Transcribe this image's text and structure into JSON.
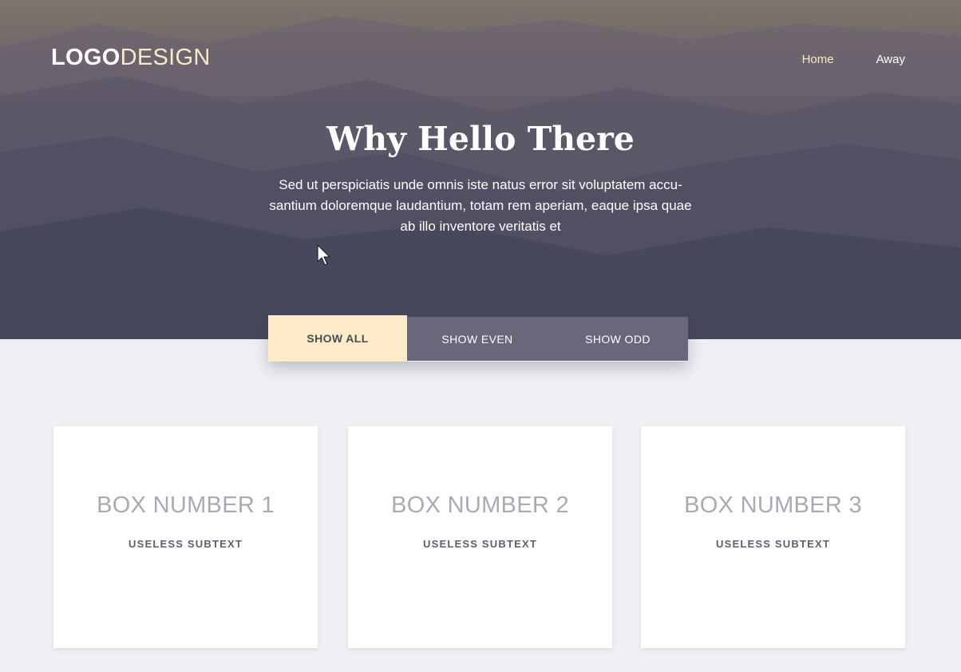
{
  "logo": {
    "part_bold": "LOGO",
    "part_light": "DESIGN"
  },
  "nav": {
    "items": [
      "Home",
      "Away"
    ]
  },
  "hero": {
    "title": "Why Hello There",
    "body": "Sed ut perspiciatis unde omnis iste natus error sit voluptatem accu-santium doloremque laudantium, totam rem aperiam, eaque ipsa quae ab illo inventore veritatis et"
  },
  "filters": {
    "active": "SHOW ALL",
    "items": [
      "SHOW ALL",
      "SHOW EVEN",
      "SHOW ODD"
    ]
  },
  "boxes": [
    {
      "title": "BOX NUMBER 1",
      "subtitle": "USELESS SUBTEXT"
    },
    {
      "title": "BOX NUMBER 2",
      "subtitle": "USELESS SUBTEXT"
    },
    {
      "title": "BOX NUMBER 3",
      "subtitle": "USELESS SUBTEXT"
    }
  ],
  "colors": {
    "accent": "#fcebc6",
    "filter_bar": "#6b6679",
    "page_bg": "#eef0f4",
    "box_title": "#a9abb3",
    "box_subtitle": "#5f5e6f"
  },
  "icons": {
    "cursor": "mouse-pointer-icon"
  }
}
